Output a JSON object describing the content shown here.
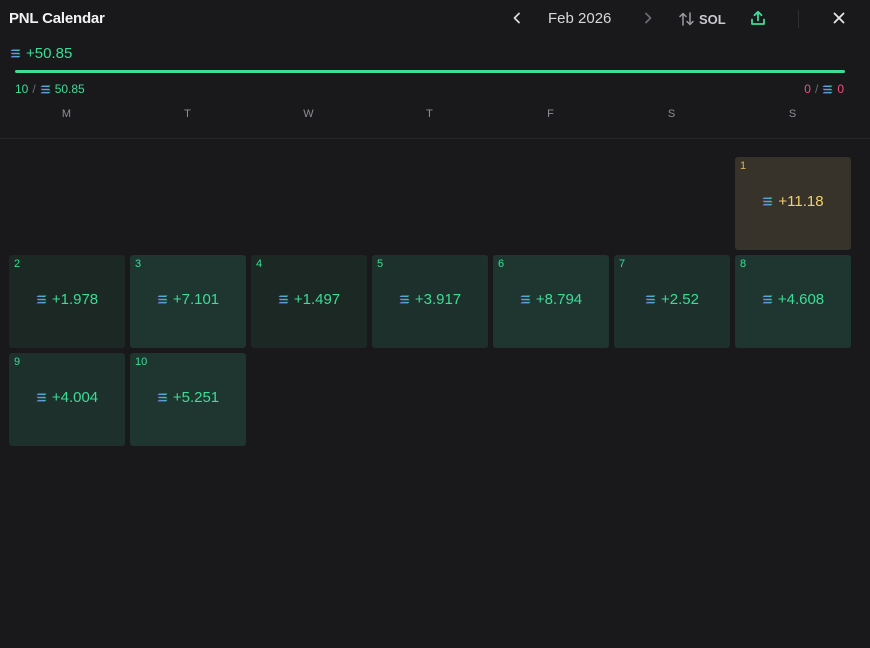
{
  "header": {
    "title": "PNL Calendar",
    "month": "Feb 2026",
    "unit": "SOL"
  },
  "summary": {
    "total": "+50.85",
    "progress_percent": 100,
    "win_days": "10",
    "win_amount": "50.85",
    "loss_days": "0",
    "loss_amount": "0"
  },
  "weekdays": [
    "M",
    "T",
    "W",
    "T",
    "F",
    "S",
    "S"
  ],
  "leading_empty_days": 6,
  "days": [
    {
      "day": "1",
      "pnl": "+11.18",
      "tone": "best"
    },
    {
      "day": "2",
      "pnl": "+1.978",
      "tone": "pos-lo"
    },
    {
      "day": "3",
      "pnl": "+7.101",
      "tone": "pos-hi"
    },
    {
      "day": "4",
      "pnl": "+1.497",
      "tone": "pos-lo"
    },
    {
      "day": "5",
      "pnl": "+3.917",
      "tone": "pos-mid"
    },
    {
      "day": "6",
      "pnl": "+8.794",
      "tone": "pos-hi"
    },
    {
      "day": "7",
      "pnl": "+2.52",
      "tone": "pos-mid"
    },
    {
      "day": "8",
      "pnl": "+4.608",
      "tone": "pos-hi"
    },
    {
      "day": "9",
      "pnl": "+4.004",
      "tone": "pos-mid"
    },
    {
      "day": "10",
      "pnl": "+5.251",
      "tone": "pos-hi"
    }
  ],
  "icons": {
    "prev": "chevron-left-icon",
    "next": "chevron-right-icon",
    "toggle": "swap-vertical-icon",
    "share": "share-upload-icon",
    "close": "close-icon",
    "currency": "solana-icon"
  },
  "colors": {
    "positive": "#3ddc97",
    "negative": "#f0517a",
    "best_day": "#f2cf6c",
    "background": "#19191b"
  }
}
